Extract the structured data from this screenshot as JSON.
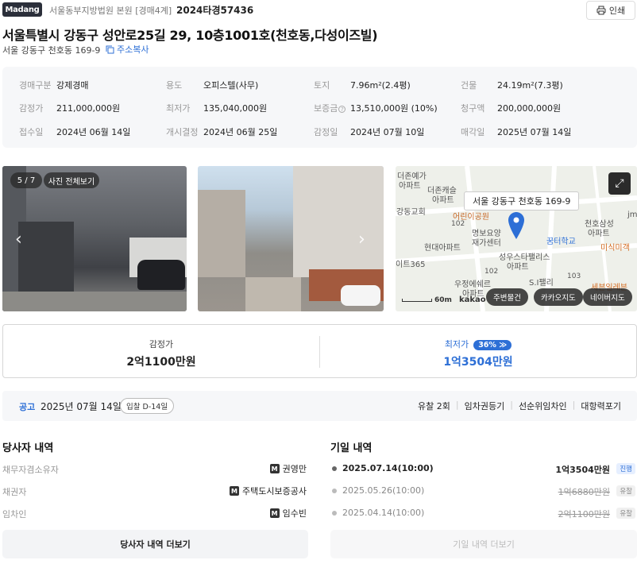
{
  "header": {
    "logo": "Madang",
    "court": "서울동부지방법원 본원 [경매4계]",
    "case_no": "2024타경57436",
    "print_label": "인쇄"
  },
  "property": {
    "title": "서울특별시 강동구 성안로25길 29, 10층1001호(천호동,다성이즈빌)",
    "address": "서울 강동구 천호동 169-9",
    "copy_label": "주소복사"
  },
  "info": {
    "type_label": "경매구분",
    "type_value": "강제경매",
    "use_label": "용도",
    "use_value": "오피스텔(사무)",
    "land_label": "토지",
    "land_value": "7.96m²(2.4평)",
    "building_label": "건물",
    "building_value": "24.19m²(7.3평)",
    "appraisal_label": "감정가",
    "appraisal_value": "211,000,000원",
    "min_label": "최저가",
    "min_value": "135,040,000원",
    "deposit_label": "보증금",
    "deposit_value": "13,510,000원 (10%)",
    "claim_label": "청구액",
    "claim_value": "200,000,000원",
    "received_label": "접수일",
    "received_value": "2024년 06월 14일",
    "start_label": "개시결정",
    "start_value": "2024년 06월 25일",
    "appraisal_date_label": "감정일",
    "appraisal_date_value": "2024년 07월 10일",
    "sold_label": "매각일",
    "sold_value": "2025년 07월 14일"
  },
  "photos": {
    "counter": "5 / 7",
    "view_all": "사진 전체보기"
  },
  "map": {
    "address_label": "서울 강동구 천호동 169-9",
    "scale": "60m",
    "kakao": "kakao",
    "btn_nearby": "주변물건",
    "btn_kakao": "카카오지도",
    "btn_naver": "네이버지도",
    "places": [
      "더존예가",
      "아파트",
      "더존캐슬",
      "아파트",
      "강동교회",
      "어린이공원",
      "명보요양",
      "재가센터",
      "현대아파트",
      "이트365",
      "천호삼성",
      "아파트",
      "꿈터학교",
      "미식미객",
      "성우스타팰리스",
      "아파트",
      "우정에쉐르",
      "아파트",
      "S.I팰리",
      "세븐일레븐",
      "102",
      "102",
      "103",
      "jm"
    ]
  },
  "price": {
    "appraisal_label": "감정가",
    "appraisal_value": "2억1100만원",
    "min_label": "최저가",
    "min_badge": "36% ≫",
    "min_value": "1억3504만원"
  },
  "notice": {
    "label": "공고",
    "date": "2025년 07월 14일",
    "badge": "입찰 D-14일",
    "tags": [
      "유찰 2회",
      "임차권등기",
      "선순위임차인",
      "대항력포기"
    ]
  },
  "parties": {
    "title": "당사자 내역",
    "rows": [
      {
        "label": "채무자겸소유자",
        "value": "권영만"
      },
      {
        "label": "채권자",
        "value": "주택도시보증공사"
      },
      {
        "label": "임차인",
        "value": "임수빈"
      }
    ],
    "badge": "M",
    "more": "당사자 내역 더보기"
  },
  "dates": {
    "title": "기일 내역",
    "rows": [
      {
        "date": "2025.07.14(10:00)",
        "price": "1억3504만원",
        "status": "진행"
      },
      {
        "date": "2025.05.26(10:00)",
        "price": "1억6880만원",
        "status": "유찰"
      },
      {
        "date": "2025.04.14(10:00)",
        "price": "2억1100만원",
        "status": "유찰"
      }
    ],
    "more": "기일 내역 더보기"
  },
  "colors": {
    "accent": "#2d6fd6",
    "dark": "#2b2f3a",
    "panel": "#f6f7f9"
  }
}
